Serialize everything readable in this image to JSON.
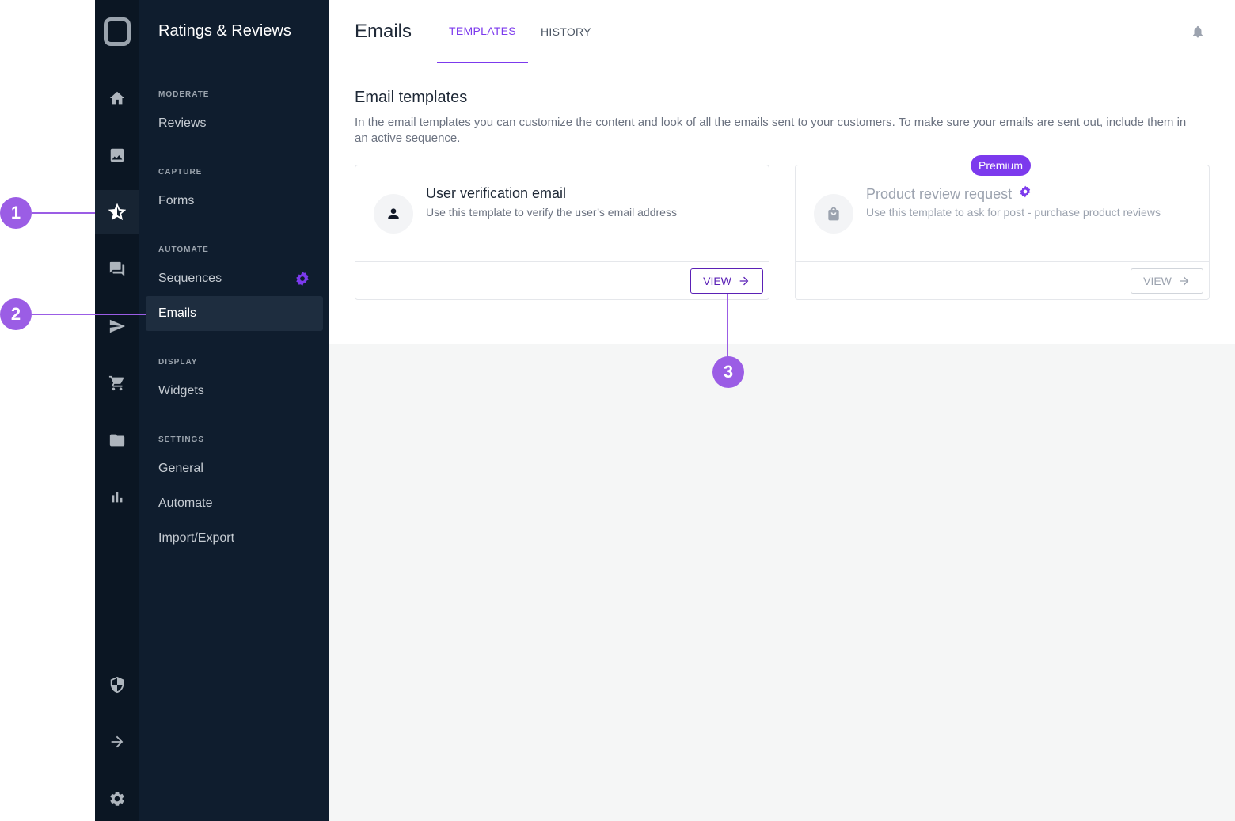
{
  "app": {
    "title": "Ratings & Reviews"
  },
  "sidebar": {
    "sections": [
      {
        "label": "MODERATE",
        "items": [
          "Reviews"
        ]
      },
      {
        "label": "CAPTURE",
        "items": [
          "Forms"
        ]
      },
      {
        "label": "AUTOMATE",
        "items": [
          "Sequences",
          "Emails"
        ]
      },
      {
        "label": "DISPLAY",
        "items": [
          "Widgets"
        ]
      },
      {
        "label": "SETTINGS",
        "items": [
          "General",
          "Automate",
          "Import/Export"
        ]
      }
    ],
    "active_item": "Emails"
  },
  "rail": {
    "icons": [
      "home-icon",
      "image-icon",
      "star-icon",
      "chat-icon",
      "send-icon",
      "cart-icon",
      "folder-icon",
      "bar-chart-icon",
      "shield-icon",
      "arrow-right-icon",
      "gear-icon"
    ],
    "active": "star-icon"
  },
  "header": {
    "title": "Emails",
    "tabs": [
      {
        "label": "TEMPLATES",
        "active": true
      },
      {
        "label": "HISTORY",
        "active": false
      }
    ]
  },
  "main": {
    "section_title": "Email templates",
    "section_desc": "In the email templates you can customize the content and look of all the emails sent to your customers. To make sure your emails are sent out, include them in an active sequence.",
    "cards": [
      {
        "title": "User verification email",
        "subtitle": "Use this template to verify the user’s email address",
        "button": "VIEW",
        "icon": "user-icon",
        "disabled": false
      },
      {
        "title": "Product review request",
        "subtitle": "Use this template to ask for post - purchase product reviews",
        "button": "VIEW",
        "icon": "shopping-bag-icon",
        "badge": "Premium",
        "disabled": true
      }
    ]
  },
  "callouts": [
    "1",
    "2",
    "3"
  ],
  "colors": {
    "accent": "#7c3aed",
    "callout": "#9b5de5",
    "rail_bg": "#0b1623",
    "sidebar_bg": "#0f1d2e"
  }
}
